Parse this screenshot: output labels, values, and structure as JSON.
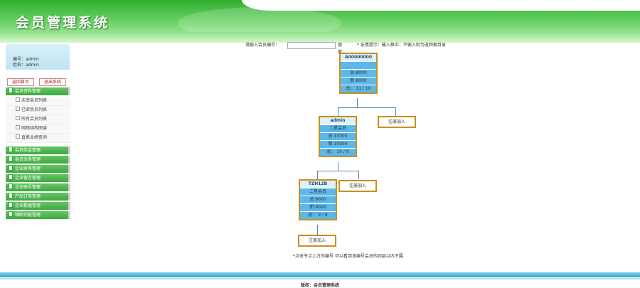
{
  "app": {
    "title": "会员管理系统"
  },
  "user": {
    "id_line": "编号：admin",
    "name_line": "姓名：admin"
  },
  "nav": {
    "home": "返回首页",
    "logout": "退出系统"
  },
  "menu": {
    "member_info": "会员资料管理",
    "member_subs": [
      "未审会员列表",
      "已审会员列表",
      "所有会员列表",
      "网络结构图谱",
      "直推业绩查询"
    ],
    "others": [
      "会员奖金管理",
      "会员关系管理",
      "企业财务管理",
      "企业留言管理",
      "企业账号管理",
      "产品订单管理",
      "企业数据管理",
      "辅助功能管理"
    ]
  },
  "search": {
    "label": "请输入会员编号：",
    "value": "",
    "button": "搜索",
    "tip": "* 友情提示：输入框中，不输入则为返回根目录"
  },
  "tree": {
    "nodes": [
      {
        "id": "A00000000",
        "level": "",
        "total": "总:8000",
        "new": "新:8000",
        "ratio": "总： 11 / 10"
      },
      {
        "id": "admin",
        "level": "二星会员",
        "total": "总:10000",
        "new": "新:10000",
        "ratio": "总： 10 / 9"
      },
      {
        "id": "TZH12B",
        "level": "二星会员",
        "total": "总:9000",
        "new": "新:9000",
        "ratio": "总： 9 / 8"
      }
    ],
    "register_label": "注册加入"
  },
  "note": "*点击节点上方的编号 可以看到该编号会员的四层以内下属.",
  "footer": {
    "copyright": "版权：会员管理系统"
  },
  "colors": {
    "header_green": "#3fae3f",
    "node_blue": "#5bb8e8",
    "node_border": "#c8901f",
    "footer_blue": "#3aa7d0"
  }
}
